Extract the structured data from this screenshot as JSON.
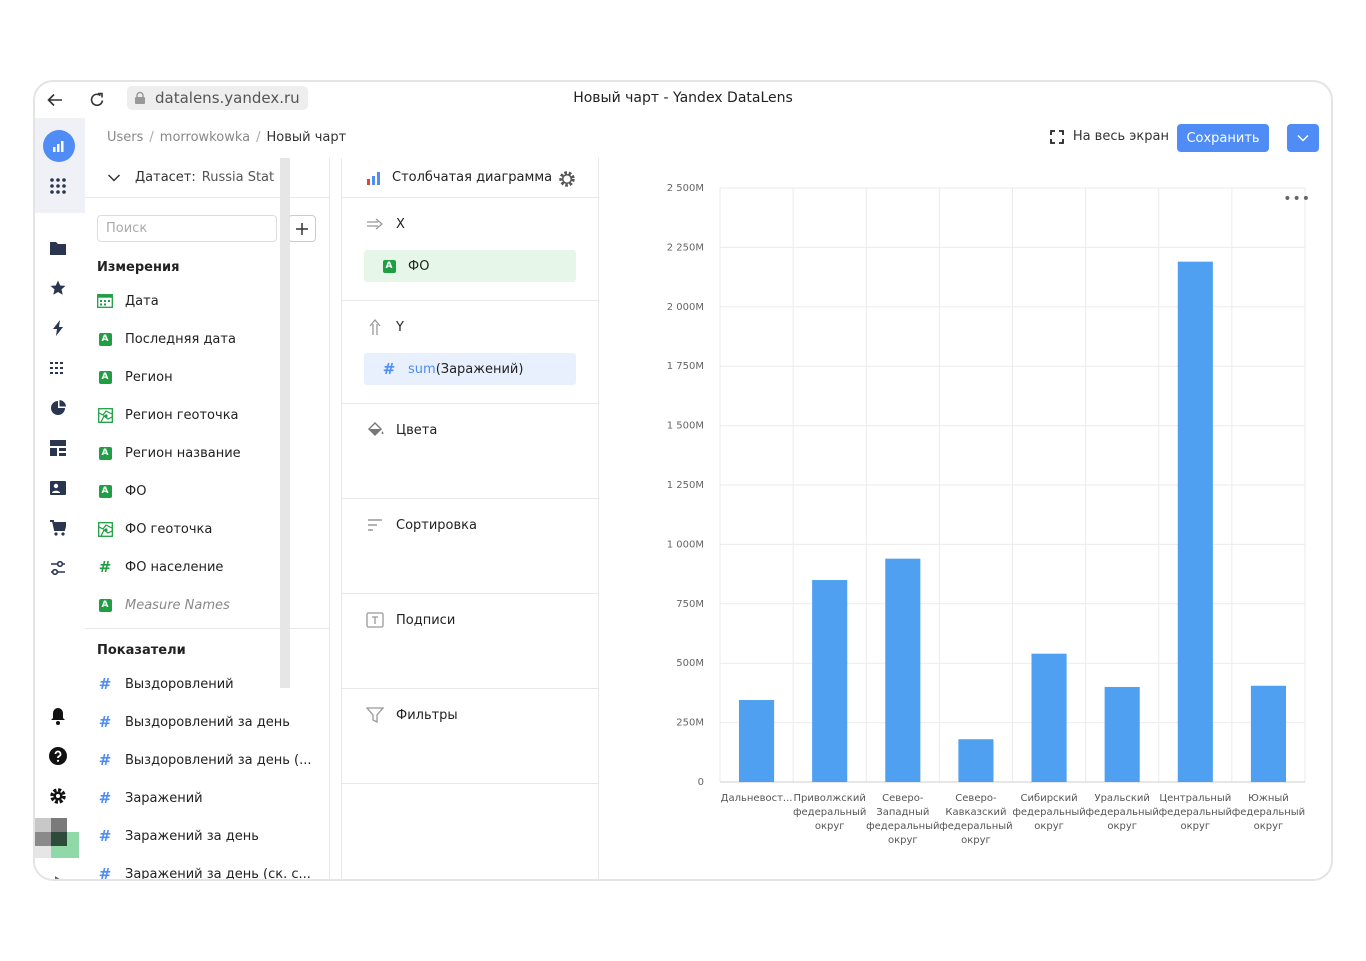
{
  "browser": {
    "url": "datalens.yandex.ru",
    "title": "Новый чарт - Yandex DataLens"
  },
  "breadcrumbs": [
    "Users",
    "morrowkowka",
    "Новый чарт"
  ],
  "header": {
    "fullscreen_label": "На весь экран",
    "save_label": "Сохранить"
  },
  "dataset": {
    "label": "Датасет:",
    "name": "Russia Stat",
    "search_placeholder": "Поиск",
    "dimensions_title": "Измерения",
    "dimensions": [
      {
        "label": "Дата",
        "icon": "calendar-icon"
      },
      {
        "label": "Последняя дата",
        "icon": "string-icon"
      },
      {
        "label": "Регион",
        "icon": "string-icon"
      },
      {
        "label": "Регион геоточка",
        "icon": "geo-icon"
      },
      {
        "label": "Регион название",
        "icon": "string-icon"
      },
      {
        "label": "ФО",
        "icon": "string-icon"
      },
      {
        "label": "ФО геоточка",
        "icon": "geo-icon"
      },
      {
        "label": "ФО население",
        "icon": "number-icon"
      },
      {
        "label": "Measure Names",
        "icon": "string-icon"
      }
    ],
    "measures_title": "Показатели",
    "measures": [
      {
        "label": "Выздоровлений"
      },
      {
        "label": "Выздоровлений за день"
      },
      {
        "label": "Выздоровлений за день (..."
      },
      {
        "label": "Заражений"
      },
      {
        "label": "Заражений за день"
      },
      {
        "label": "Заражений за день (ск. с..."
      }
    ]
  },
  "visualization": {
    "type_label": "Столбчатая диаграмма",
    "x_label": "X",
    "x_field": "ФО",
    "y_label": "Y",
    "y_field_func": "sum",
    "y_field_name": "(Заражений)",
    "colors_label": "Цвета",
    "sort_label": "Сортировка",
    "labels_label": "Подписи",
    "filters_label": "Фильтры",
    "badge_letter": "A"
  },
  "chart_data": {
    "type": "bar",
    "categories": [
      [
        "Дальневост..."
      ],
      [
        "Приволжский",
        "федеральный",
        "округ"
      ],
      [
        "Северо-",
        "Западный",
        "федеральный",
        "округ"
      ],
      [
        "Северо-",
        "Кавказский",
        "федеральный",
        "округ"
      ],
      [
        "Сибирский",
        "федеральный",
        "округ"
      ],
      [
        "Уральский",
        "федеральный",
        "округ"
      ],
      [
        "Центральный",
        "федеральный",
        "округ"
      ],
      [
        "Южный",
        "федеральный",
        "округ"
      ]
    ],
    "values": [
      345,
      850,
      940,
      180,
      540,
      400,
      2190,
      405
    ],
    "unit": "M",
    "ylim": [
      0,
      2500
    ],
    "yticks": [
      {
        "v": 0,
        "label": "0"
      },
      {
        "v": 250,
        "label": "250M"
      },
      {
        "v": 500,
        "label": "500M"
      },
      {
        "v": 750,
        "label": "750M"
      },
      {
        "v": 1000,
        "label": "1 000M"
      },
      {
        "v": 1250,
        "label": "1 250M"
      },
      {
        "v": 1500,
        "label": "1 500M"
      },
      {
        "v": 1750,
        "label": "1 750M"
      },
      {
        "v": 2000,
        "label": "2 000M"
      },
      {
        "v": 2250,
        "label": "2 250M"
      },
      {
        "v": 2500,
        "label": "2 500M"
      }
    ],
    "bar_color": "#4fa0f0",
    "grid": true
  }
}
